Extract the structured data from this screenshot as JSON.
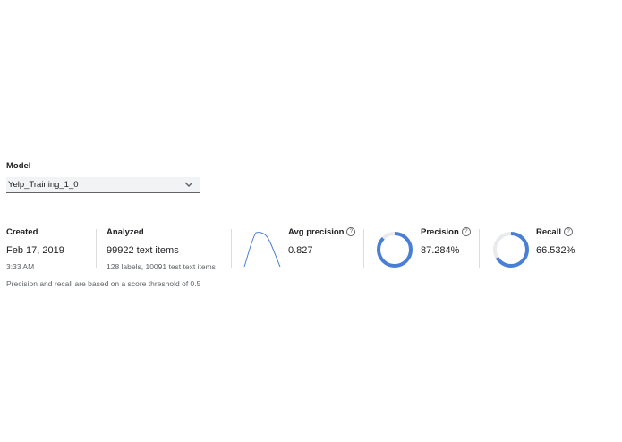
{
  "model": {
    "label": "Model",
    "selected": "Yelp_Training_1_0"
  },
  "created": {
    "heading": "Created",
    "date": "Feb 17, 2019",
    "time": "3:33 AM"
  },
  "analyzed": {
    "heading": "Analyzed",
    "items": "99922 text items",
    "details": "128 labels, 10091 test text items"
  },
  "avg_precision": {
    "heading": "Avg precision",
    "value": "0.827"
  },
  "precision": {
    "heading": "Precision",
    "value": "87.284%",
    "fraction": 0.87284
  },
  "recall": {
    "heading": "Recall",
    "value": "66.532%",
    "fraction": 0.66532
  },
  "footnote": "Precision and recall are based on a score threshold of 0.5",
  "colors": {
    "accent": "#4a7fd6",
    "track": "#e8eaed"
  },
  "icons": {
    "dropdown": "chevron-down-icon",
    "help": "help-circle-icon"
  }
}
